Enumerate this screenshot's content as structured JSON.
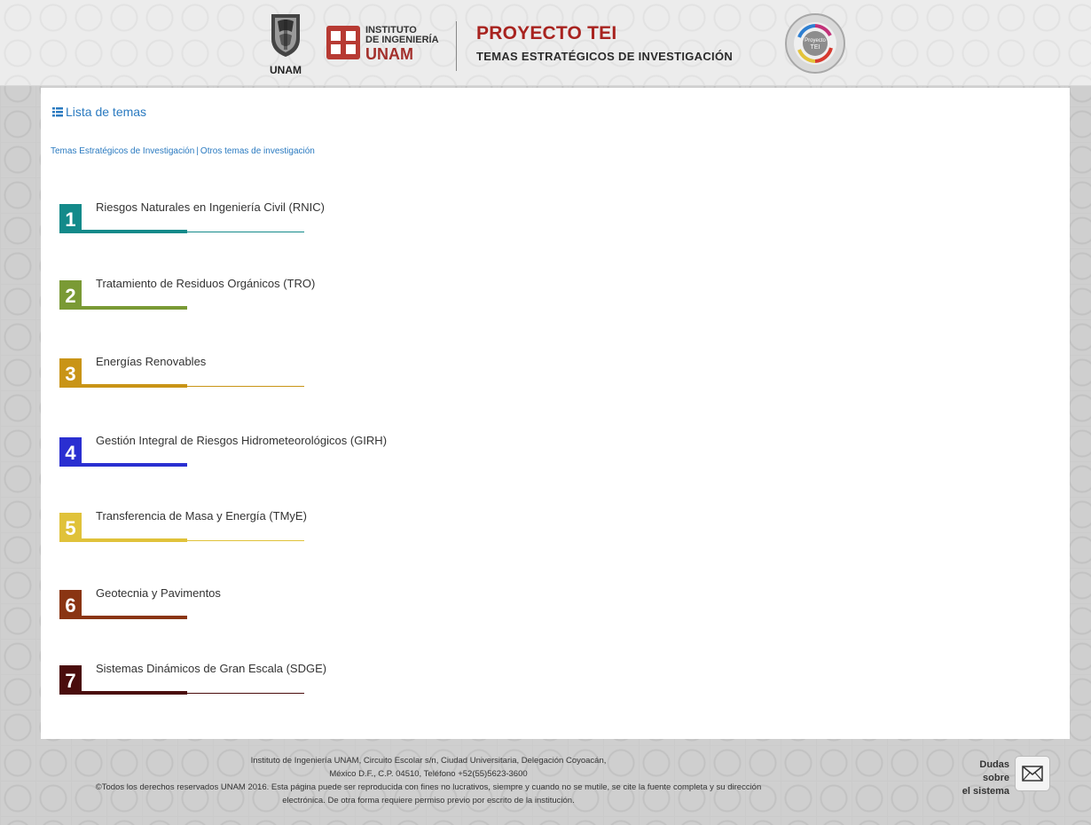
{
  "header": {
    "unam_logo_text": "UNAM",
    "institute_line1": "INSTITUTO",
    "institute_line2": "DE INGENIERÍA",
    "institute_line3": "UNAM",
    "project_title": "PROYECTO TEI",
    "project_subtitle": "TEMAS ESTRATÉGICOS DE INVESTIGACIÓN",
    "badge_text": "Proyecto TEI"
  },
  "main": {
    "list_link_label": "Lista de temas",
    "subnav": {
      "tei_label": "Temas Estratégicos de Investigación",
      "separator": "|",
      "other_label": "Otros temas de investigación"
    },
    "topics": [
      {
        "number": "1",
        "label": "Riesgos Naturales en Ingeniería Civil (RNIC)",
        "color": "#138a8a"
      },
      {
        "number": "2",
        "label": "Tratamiento de Residuos Orgánicos (TRO)",
        "color": "#7a9a35"
      },
      {
        "number": "3",
        "label": "Energías Renovables",
        "color": "#c99416"
      },
      {
        "number": "4",
        "label": "Gestión Integral de Riesgos Hidrometeorológicos (GIRH)",
        "color": "#2a2fd1"
      },
      {
        "number": "5",
        "label": "Transferencia de Masa y Energía (TMyE)",
        "color": "#e0c23a"
      },
      {
        "number": "6",
        "label": "Geotecnia y Pavimentos",
        "color": "#8a3513"
      },
      {
        "number": "7",
        "label": "Sistemas Dinámicos de Gran Escala (SDGE)",
        "color": "#4a0d0d"
      }
    ]
  },
  "footer": {
    "address_line1": "Instituto de Ingeniería UNAM, Circuito Escolar s/n, Ciudad Universitaria, Delegación Coyoacán,",
    "address_line2": "México D.F., C.P. 04510, Teléfono +52(55)5623-3600",
    "rights_line1": "©Todos los derechos reservados UNAM 2016. Esta página puede ser reproducida con fines no lucrativos, siempre y cuando no se mutile, se cite la fuente completa y su dirección",
    "rights_line2": "electrónica. De otra forma requiere permiso previo por escrito de la institución.",
    "contact_line1": "Dudas sobre",
    "contact_line2": "el sistema"
  },
  "icons": {
    "list": "list-icon",
    "mail": "mail-icon"
  }
}
